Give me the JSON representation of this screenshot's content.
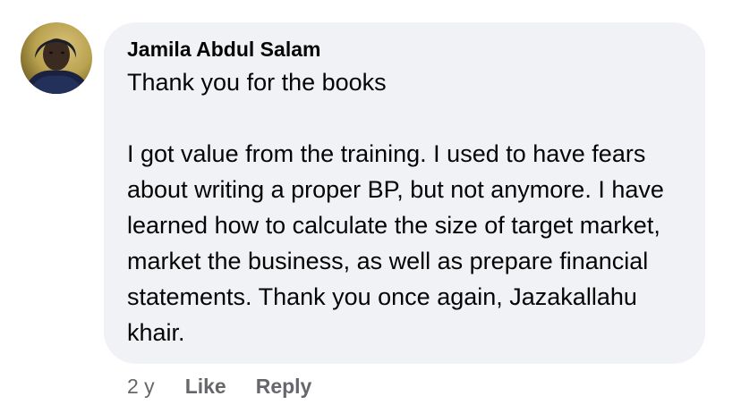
{
  "comment": {
    "author": "Jamila Abdul Salam",
    "paragraphs": [
      "Thank you for the books",
      "I got value from the training. I used to have fears about writing a proper BP, but not anymore. I have learned how to calculate the size of target market, market the business, as well as prepare financial statements. Thank you once again, Jazakallahu khair."
    ],
    "avatar_icon": "profile-photo",
    "timestamp": "2 y",
    "like_label": "Like",
    "reply_label": "Reply"
  },
  "colors": {
    "bubble_background": "#f0f2f5",
    "text_primary": "#050505",
    "text_secondary": "#65676b"
  }
}
